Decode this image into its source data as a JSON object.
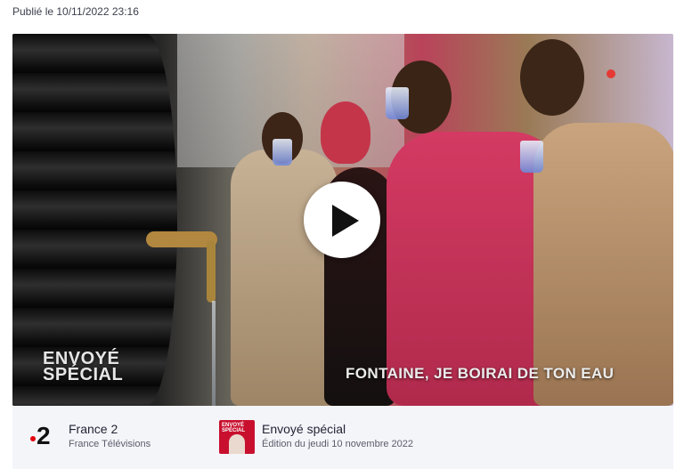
{
  "published": "Publié le 10/11/2022 23:16",
  "video": {
    "show_logo_line1": "ENVOYÉ",
    "show_logo_line2": "SPÉCIAL",
    "caption": "FONTAINE, JE BOIRAI DE TON EAU",
    "play_icon": "play-icon"
  },
  "meta": {
    "channel_logo": "2",
    "channel_name": "France 2",
    "channel_group": "France Télévisions",
    "show_thumb_text": "ENVOYÉ SPÉCIAL",
    "show_name": "Envoyé spécial",
    "show_edition": "Édition du jeudi 10 novembre 2022"
  },
  "colors": {
    "channel_dot": "#e3000f",
    "show_thumb_bg": "#c8102e",
    "meta_bar_bg": "#f4f5f9"
  }
}
